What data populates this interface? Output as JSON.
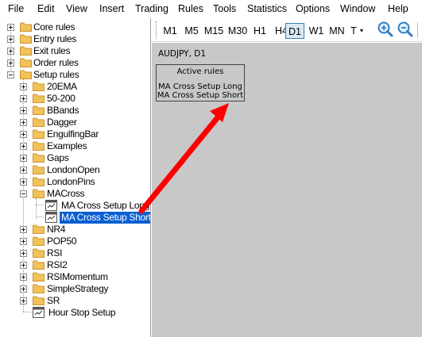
{
  "menu": [
    "File",
    "Edit",
    "View",
    "Insert",
    "Trading",
    "Rules",
    "Tools",
    "Statistics",
    "Options",
    "Window",
    "Help"
  ],
  "tree": {
    "core_rules": "Core rules",
    "entry_rules": "Entry rules",
    "exit_rules": "Exit rules",
    "order_rules": "Order rules",
    "setup_rules": "Setup rules",
    "folders_a": [
      "20EMA",
      "50-200",
      "BBands",
      "Dagger",
      "EngulfingBar",
      "Examples",
      "Gaps",
      "LondonOpen",
      "LondonPins"
    ],
    "macross": "MACross",
    "macross_children": [
      "MA Cross Setup Long",
      "MA Cross Setup Short"
    ],
    "folders_b": [
      "NR4",
      "POP50",
      "RSI",
      "RSI2",
      "RSIMomentum",
      "SimpleStrategy",
      "SR"
    ],
    "hour_stop": "Hour Stop Setup"
  },
  "toolbar": {
    "timeframes": [
      "M1",
      "M5",
      "M15",
      "M30",
      "H1",
      "H4",
      "D1",
      "W1",
      "MN"
    ],
    "active_timeframe": "D1",
    "template_label": "T"
  },
  "chart": {
    "title": "AUDJPY, D1",
    "box_header": "Active rules",
    "box_lines": [
      "MA Cross Setup Long",
      "MA Cross Setup Short"
    ]
  },
  "colors": {
    "selection": "#0a5fd1",
    "arrow": "#ff0000",
    "chart_bg": "#c8c8c8",
    "folder": "#f2c25a"
  },
  "icons": {
    "zoom_in": "zoom-in-icon",
    "zoom_out": "zoom-out-icon",
    "folder": "folder-icon",
    "rule_file": "rule-file-icon"
  }
}
